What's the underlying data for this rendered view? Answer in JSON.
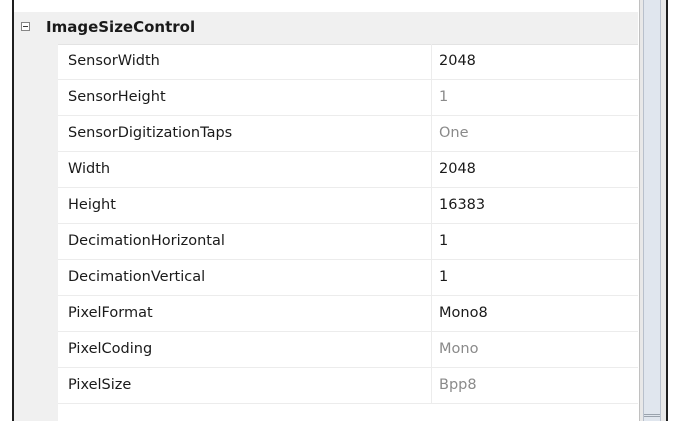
{
  "category": {
    "label": "ImageSizeControl",
    "expander_icon": "minus-box-icon"
  },
  "properties": [
    {
      "name": "SensorWidth",
      "value": "2048",
      "readonly": false
    },
    {
      "name": "SensorHeight",
      "value": "1",
      "readonly": true
    },
    {
      "name": "SensorDigitizationTaps",
      "value": "One",
      "readonly": true
    },
    {
      "name": "Width",
      "value": "2048",
      "readonly": false
    },
    {
      "name": "Height",
      "value": "16383",
      "readonly": false
    },
    {
      "name": "DecimationHorizontal",
      "value": "1",
      "readonly": false
    },
    {
      "name": "DecimationVertical",
      "value": "1",
      "readonly": false
    },
    {
      "name": "PixelFormat",
      "value": "Mono8",
      "readonly": false
    },
    {
      "name": "PixelCoding",
      "value": "Mono",
      "readonly": true
    },
    {
      "name": "PixelSize",
      "value": "Bpp8",
      "readonly": true
    }
  ],
  "colors": {
    "category_background": "#f0f0f0",
    "readonly_text": "#8a8a8a",
    "editable_text": "#1a1a1a"
  }
}
